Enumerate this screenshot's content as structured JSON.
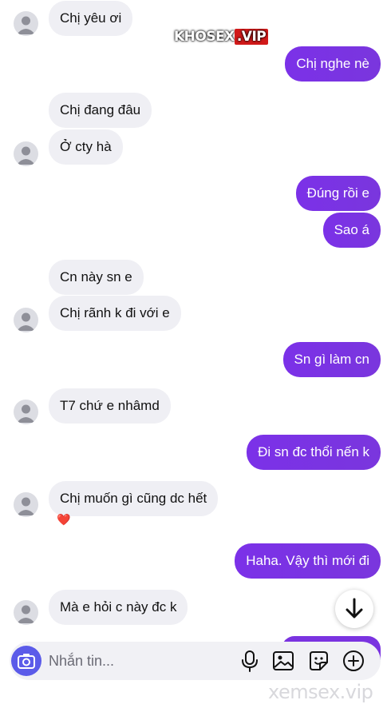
{
  "watermark": {
    "brand": "KHOSEX",
    "suffix": ".VIP"
  },
  "messages": [
    {
      "text": "Chị yêu ơi"
    },
    {
      "text": "Chị nghe nè"
    },
    {
      "text": "Chị đang đâu"
    },
    {
      "text": "Ở cty hà"
    },
    {
      "text": "Đúng rồi e"
    },
    {
      "text": "Sao á"
    },
    {
      "text": "Cn này sn e"
    },
    {
      "text": "Chị rãnh k đi với e"
    },
    {
      "text": "Sn gì làm cn"
    },
    {
      "text": "T7 chứ e nhâmd"
    },
    {
      "text": "Đi sn đc thổi nến k"
    },
    {
      "text": "Chị muốn gì cũng dc hết"
    },
    {
      "text": "Haha. Vậy thì mới đi"
    },
    {
      "text": "Mà e hỏi c này đc k"
    }
  ],
  "reaction": "❤️",
  "composer": {
    "placeholder": "Nhắn tin..."
  },
  "footer_watermark": "xemsex.vip",
  "colors": {
    "outgoing": "#7a33e0",
    "incoming": "#efeff4",
    "camera": "#5b5be9"
  }
}
